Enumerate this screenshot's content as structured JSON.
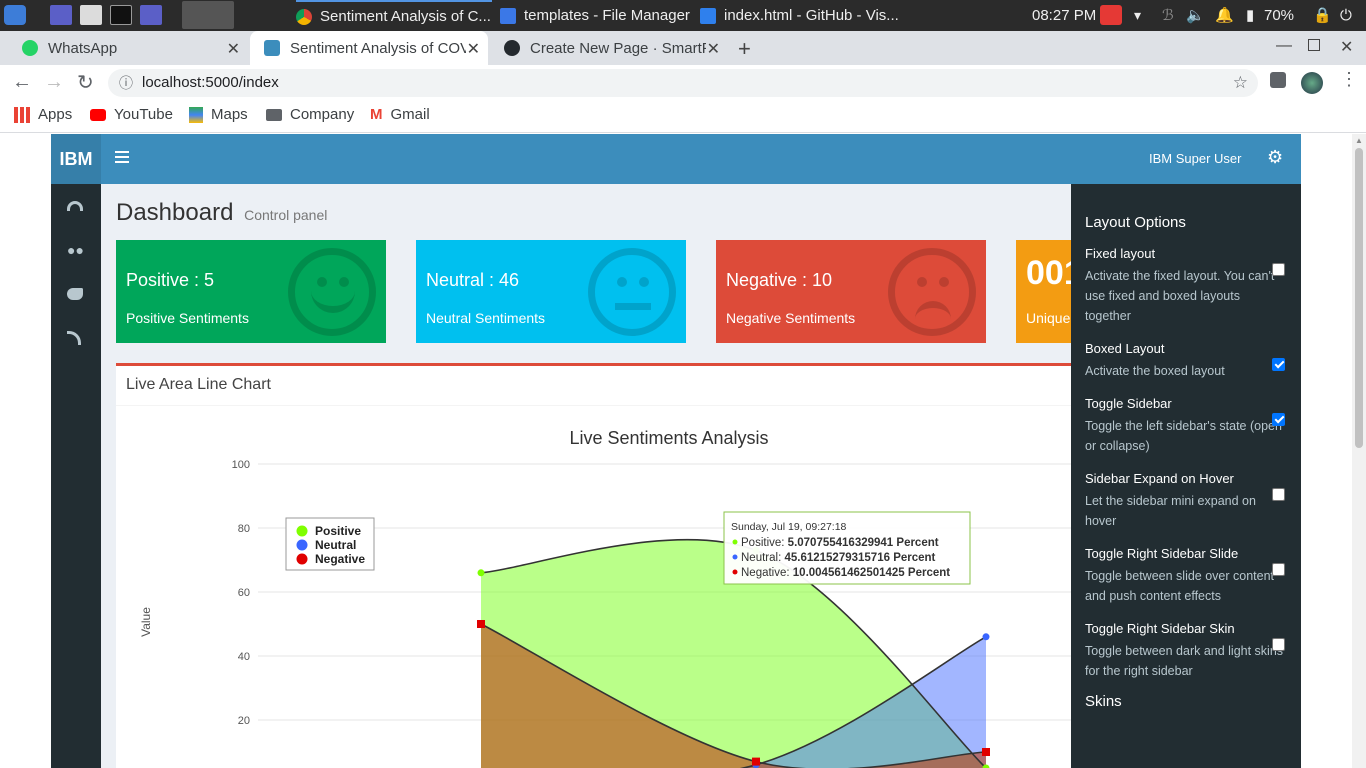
{
  "taskbar": {
    "windows": [
      {
        "label": "Sentiment Analysis of C..."
      },
      {
        "label": "templates - File Manager"
      },
      {
        "label": "index.html - GitHub - Vis..."
      }
    ],
    "clock": "08:27 PM",
    "battery": "70%"
  },
  "browser": {
    "tabs": [
      {
        "title": "WhatsApp"
      },
      {
        "title": "Sentiment Analysis of COV"
      },
      {
        "title": "Create New Page · SmartF"
      }
    ],
    "url": "localhost:5000/index",
    "bookmarks": [
      {
        "label": "Apps"
      },
      {
        "label": "YouTube"
      },
      {
        "label": "Maps"
      },
      {
        "label": "Company"
      },
      {
        "label": "Gmail"
      }
    ]
  },
  "app": {
    "logo": "IBM",
    "user": "IBM Super User",
    "page_title": "Dashboard",
    "page_subtitle": "Control panel",
    "boxes": [
      {
        "count": "Positive : 5",
        "label": "Positive Sentiments",
        "color": "#00a65a"
      },
      {
        "count": "Neutral : 46",
        "label": "Neutral Sentiments",
        "color": "#00c0ef"
      },
      {
        "count": "Negative : 10",
        "label": "Negative Sentiments",
        "color": "#dd4b39"
      },
      {
        "count": "001",
        "label": "Unique",
        "color": "#f39c12"
      }
    ],
    "chart_box_title": "Live Area Line Chart"
  },
  "right_panel": {
    "heading": "Layout Options",
    "options": [
      {
        "title": "Fixed layout",
        "desc": "Activate the fixed layout. You can't use fixed and boxed layouts together",
        "checked": false
      },
      {
        "title": "Boxed Layout",
        "desc": "Activate the boxed layout",
        "checked": true
      },
      {
        "title": "Toggle Sidebar",
        "desc": "Toggle the left sidebar's state (open or collapse)",
        "checked": true
      },
      {
        "title": "Sidebar Expand on Hover",
        "desc": "Let the sidebar mini expand on hover",
        "checked": false
      },
      {
        "title": "Toggle Right Sidebar Slide",
        "desc": "Toggle between slide over content and push content effects",
        "checked": false
      },
      {
        "title": "Toggle Right Sidebar Skin",
        "desc": "Toggle between dark and light skins for the right sidebar",
        "checked": false
      }
    ],
    "skins_heading": "Skins"
  },
  "chart_data": {
    "type": "area",
    "title": "Live Sentiments Analysis",
    "ylabel": "Value",
    "ylim": [
      0,
      100
    ],
    "yticks": [
      "20",
      "40",
      "60",
      "80",
      "100"
    ],
    "legend_position": "top-left",
    "series": [
      {
        "name": "Positive",
        "color": "#7fff00",
        "values": [
          66,
          73,
          5
        ]
      },
      {
        "name": "Neutral",
        "color": "#3a66ff",
        "values": [
          1,
          6,
          46
        ]
      },
      {
        "name": "Negative",
        "color": "#e00000",
        "values": [
          50,
          7,
          10
        ]
      }
    ],
    "tooltip": {
      "header": "Sunday, Jul 19, 09:27:18",
      "rows": [
        {
          "name": "Positive",
          "value": "5.070755416329941",
          "unit": "Percent"
        },
        {
          "name": "Neutral",
          "value": "45.61215279315716",
          "unit": "Percent"
        },
        {
          "name": "Negative",
          "value": "10.004561462501425",
          "unit": "Percent"
        }
      ]
    }
  }
}
